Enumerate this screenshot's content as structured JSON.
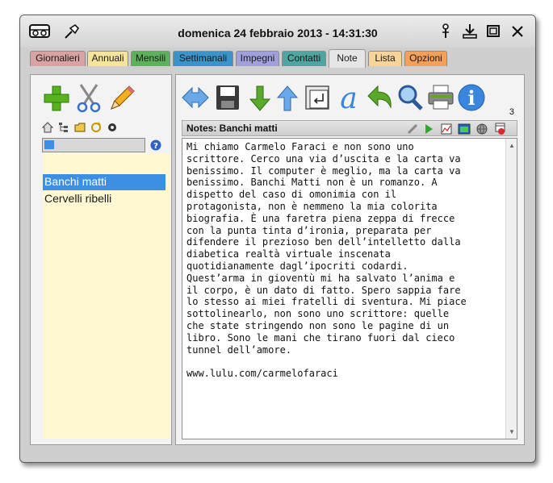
{
  "titlebar": {
    "title": "domenica 24 febbraio 2013 - 14:31:30",
    "left_icons": [
      "app-icon",
      "pin-icon"
    ],
    "right_icons": [
      "pin-down-icon",
      "minimize-to-tray-icon",
      "maximize-icon",
      "close-icon"
    ]
  },
  "tabs": [
    {
      "label": "Giornalieri",
      "color": "#d9a3a3"
    },
    {
      "label": "Annuali",
      "color": "#f6e39c"
    },
    {
      "label": "Mensili",
      "color": "#5db15a"
    },
    {
      "label": "Settimanali",
      "color": "#3b94c9"
    },
    {
      "label": "Impegni",
      "color": "#a1a0dc"
    },
    {
      "label": "Contatti",
      "color": "#4fa5a0"
    },
    {
      "label": "Note",
      "color": "#e6e6e6",
      "active": true
    },
    {
      "label": "Lista",
      "color": "#f6d49a"
    },
    {
      "label": "Opzioni",
      "color": "#f3a15a"
    }
  ],
  "left": {
    "toolbar": [
      "add-icon",
      "cut-icon",
      "edit-icon"
    ],
    "small_toolbar": [
      "home-icon",
      "tree-icon",
      "folder-icon",
      "refresh-icon",
      "settings-icon"
    ],
    "search_value": "",
    "help_icon": "help-icon",
    "items": [
      {
        "label": "Banchi matti",
        "selected": true
      },
      {
        "label": "Cervelli ribelli",
        "selected": false
      }
    ]
  },
  "right": {
    "toolbar": [
      "move-icon",
      "save-icon",
      "down-arrow-icon",
      "up-arrow-icon",
      "wrap-icon",
      "font-icon",
      "undo-icon",
      "search-icon",
      "print-icon",
      "info-icon"
    ],
    "page_count": "3",
    "note_title": "Notes: Banchi matti",
    "header_icons": [
      "pen-icon",
      "play-icon",
      "chart-icon",
      "image-icon",
      "globe-icon",
      "calendar-alert-icon"
    ],
    "note_text": "Mi chiamo Carmelo Faraci e non sono uno\nscrittore. Cerco una via d’uscita e la carta va\nbenissimo. Il computer è meglio, ma la carta va\nbenissimo. Banchi Matti non è un romanzo. A\ndispetto del caso di omonimia con il\nprotagonista, non è nemmeno la mia colorita\nbiografia. È una faretra piena zeppa di frecce\ncon la punta tinta d’ironia, preparata per\ndifendere il prezioso ben dell’intelletto dalla\ndiabetica realtà virtuale inscenata\nquotidianamente dagl’ipocriti codardi.\nQuest’arma in gioventù mi ha salvato l’anima e\nil corpo, è un dato di fatto. Spero sappia fare\nlo stesso ai miei fratelli di sventura. Mi piace\nsottolinearlo, non sono uno scrittore: quelle\nche state stringendo non sono le pagine di un\nlibro. Sono le mani che tirano fuori dal cieco\ntunnel dell’amore.\n\nwww.lulu.com/carmelofaraci"
  }
}
